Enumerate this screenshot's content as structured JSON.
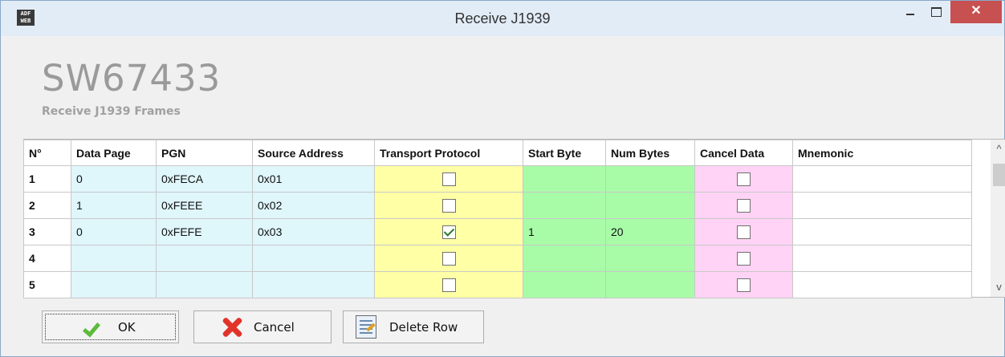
{
  "window": {
    "title": "Receive J1939",
    "app_icon_text": "ADF\nWEB",
    "close_glyph": "✕"
  },
  "header": {
    "product": "SW67433",
    "subtitle": "Receive J1939 Frames"
  },
  "table": {
    "columns": [
      "N°",
      "Data Page",
      "PGN",
      "Source Address",
      "Transport Protocol",
      "Start Byte",
      "Num Bytes",
      "Cancel Data",
      "Mnemonic"
    ],
    "rows": [
      {
        "n": "1",
        "data_page": "0",
        "pgn": "0xFECA",
        "source_address": "0x01",
        "transport_protocol": false,
        "start_byte": "",
        "num_bytes": "",
        "cancel_data": false,
        "mnemonic": ""
      },
      {
        "n": "2",
        "data_page": "1",
        "pgn": "0xFEEE",
        "source_address": "0x02",
        "transport_protocol": false,
        "start_byte": "",
        "num_bytes": "",
        "cancel_data": false,
        "mnemonic": ""
      },
      {
        "n": "3",
        "data_page": "0",
        "pgn": "0xFEFE",
        "source_address": "0x03",
        "transport_protocol": true,
        "start_byte": "1",
        "num_bytes": "20",
        "cancel_data": false,
        "mnemonic": ""
      },
      {
        "n": "4",
        "data_page": "",
        "pgn": "",
        "source_address": "",
        "transport_protocol": false,
        "start_byte": "",
        "num_bytes": "",
        "cancel_data": false,
        "mnemonic": ""
      },
      {
        "n": "5",
        "data_page": "",
        "pgn": "",
        "source_address": "",
        "transport_protocol": false,
        "start_byte": "",
        "num_bytes": "",
        "cancel_data": false,
        "mnemonic": ""
      }
    ]
  },
  "scrollbar": {
    "up_glyph": "^",
    "down_glyph": "v"
  },
  "buttons": {
    "ok": "OK",
    "cancel": "Cancel",
    "delete_row": "Delete Row"
  },
  "colors": {
    "cyan_cells": "#dff6fb",
    "yellow_cells": "#ffffa6",
    "green_cells": "#a8fca8",
    "pink_cells": "#ffd3f5",
    "close_button": "#c75050"
  },
  "icons": {
    "app": "adfweb-logo-icon",
    "ok": "checkmark-icon",
    "cancel": "red-x-icon",
    "delete": "document-edit-icon"
  }
}
